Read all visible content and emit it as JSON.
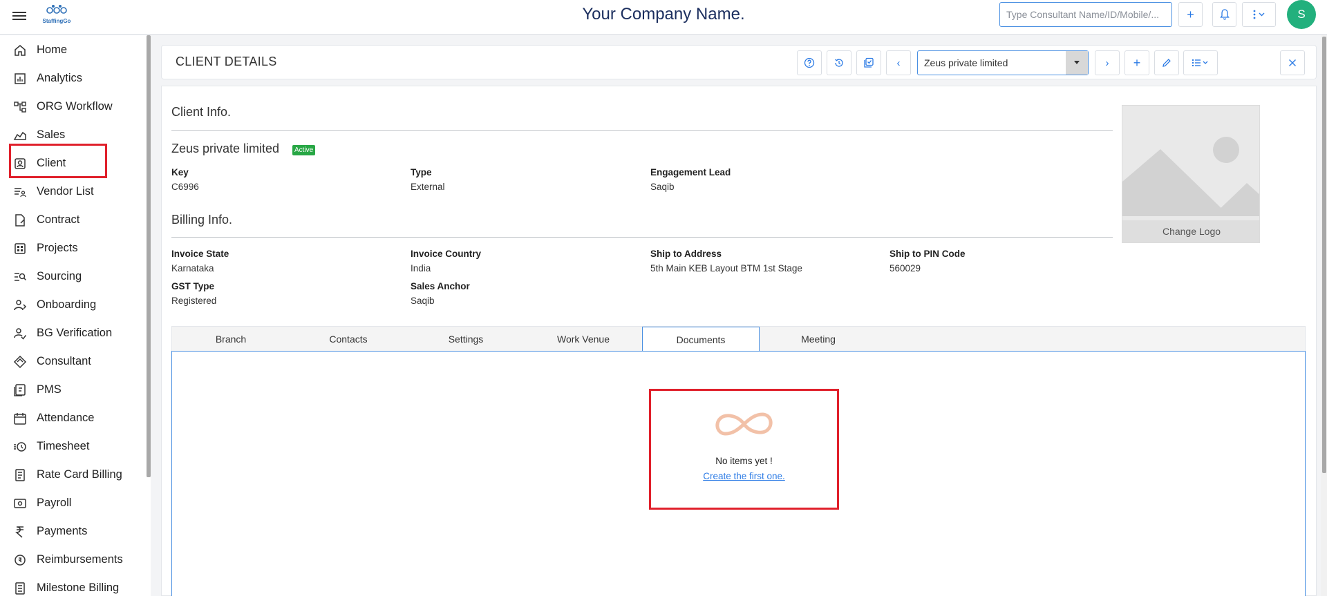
{
  "topbar": {
    "company_name": "Your Company Name.",
    "logo_text": "StaffingGo",
    "search_placeholder": "Type Consultant Name/ID/Mobile/...",
    "avatar_initial": "S",
    "accent": "#2c7be5"
  },
  "sidebar": {
    "items": [
      {
        "label": "Home",
        "icon": "home-icon"
      },
      {
        "label": "Analytics",
        "icon": "analytics-icon"
      },
      {
        "label": "ORG Workflow",
        "icon": "workflow-icon"
      },
      {
        "label": "Sales",
        "icon": "sales-icon"
      },
      {
        "label": "Client",
        "icon": "client-icon"
      },
      {
        "label": "Vendor List",
        "icon": "vendor-list-icon"
      },
      {
        "label": "Contract",
        "icon": "contract-icon"
      },
      {
        "label": "Projects",
        "icon": "projects-icon"
      },
      {
        "label": "Sourcing",
        "icon": "sourcing-icon"
      },
      {
        "label": "Onboarding",
        "icon": "onboarding-icon"
      },
      {
        "label": "BG Verification",
        "icon": "bg-verification-icon"
      },
      {
        "label": "Consultant",
        "icon": "consultant-icon"
      },
      {
        "label": "PMS",
        "icon": "pms-icon"
      },
      {
        "label": "Attendance",
        "icon": "attendance-icon"
      },
      {
        "label": "Timesheet",
        "icon": "timesheet-icon"
      },
      {
        "label": "Rate Card Billing",
        "icon": "rate-card-icon"
      },
      {
        "label": "Payroll",
        "icon": "payroll-icon"
      },
      {
        "label": "Payments",
        "icon": "rupee-icon"
      },
      {
        "label": "Reimbursements",
        "icon": "reimbursements-icon"
      },
      {
        "label": "Milestone Billing",
        "icon": "milestone-billing-icon"
      }
    ],
    "selected": "Client"
  },
  "header": {
    "title": "CLIENT DETAILS",
    "selected_client": "Zeus private limited"
  },
  "client_info": {
    "section_title": "Client Info.",
    "name": "Zeus private limited",
    "status": "Active",
    "fields": [
      {
        "label": "Key",
        "value": "C6996"
      },
      {
        "label": "Type",
        "value": "External"
      },
      {
        "label": "Engagement Lead",
        "value": "Saqib"
      }
    ]
  },
  "billing_info": {
    "section_title": "Billing Info.",
    "fields": [
      {
        "label": "Invoice State",
        "value": "Karnataka"
      },
      {
        "label": "Invoice Country",
        "value": "India"
      },
      {
        "label": "Ship to Address",
        "value": "5th Main KEB Layout BTM 1st Stage"
      },
      {
        "label": "Ship to PIN Code",
        "value": "560029"
      },
      {
        "label": "GST Type",
        "value": "Registered"
      },
      {
        "label": "Sales Anchor",
        "value": "Saqib"
      }
    ]
  },
  "logo_panel": {
    "change_label": "Change Logo"
  },
  "tabs": {
    "items": [
      "Branch",
      "Contacts",
      "Settings",
      "Work Venue",
      "Documents",
      "Meeting"
    ],
    "active": "Documents"
  },
  "documents": {
    "empty_text": "No items yet !",
    "create_link": "Create the first one."
  }
}
